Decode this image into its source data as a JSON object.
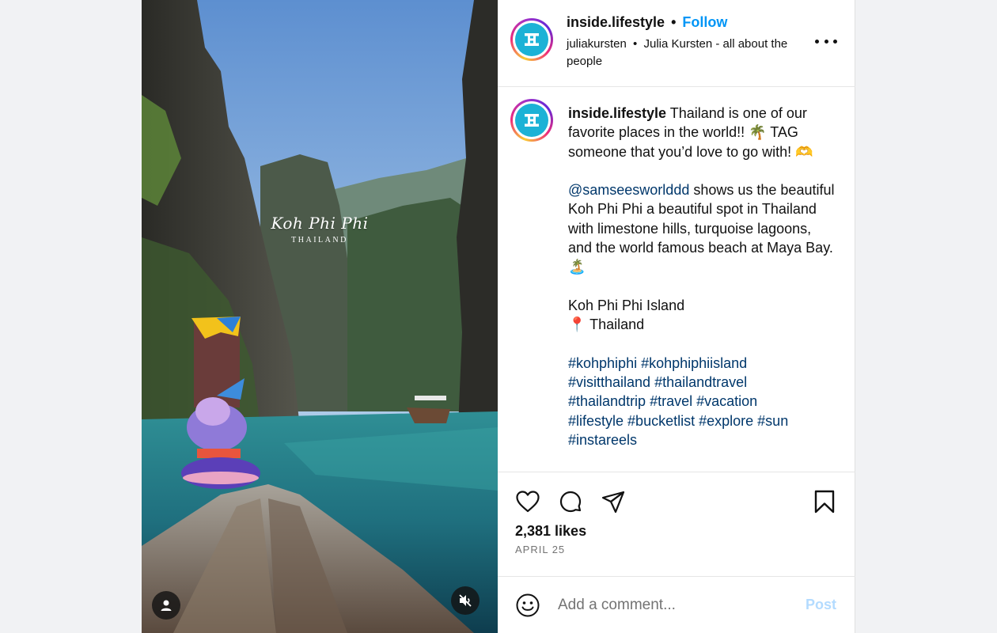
{
  "media": {
    "overlay_title": "Koh Phi Phi",
    "overlay_subtitle": "THAILAND",
    "tag_icon": "user-icon",
    "mute_icon": "speaker-muted-icon"
  },
  "header": {
    "username": "inside.lifestyle",
    "separator": "•",
    "follow_label": "Follow",
    "audio_author": "juliakursten",
    "audio_separator": "•",
    "audio_title": "Julia Kursten - all about the people",
    "more_icon": "more-horizontal-icon"
  },
  "caption": {
    "username": "inside.lifestyle",
    "intro": "Thailand is one of our favorite places in the world!! 🌴 TAG someone that you’d love to go with! 🫶",
    "mention": "@samseesworlddd",
    "body": "shows us the beautiful Koh Phi Phi a beautiful spot in Thailand with limestone hills, turquoise lagoons, and the world famous beach at Maya Bay. 🏝️",
    "location_line1": "Koh Phi Phi Island",
    "location_line2": "📍 Thailand",
    "hashtags": [
      "#kohphiphi",
      "#kohphiphiisland",
      "#visitthailand",
      "#thailandtravel",
      "#thailandtrip",
      "#travel",
      "#vacation",
      "#lifestyle",
      "#bucketlist",
      "#explore",
      "#sun",
      "#instareels"
    ]
  },
  "actions": {
    "like_icon": "heart-icon",
    "comment_icon": "comment-icon",
    "share_icon": "send-icon",
    "save_icon": "bookmark-icon",
    "likes_text": "2,381 likes",
    "date_text": "APRIL 25"
  },
  "comment": {
    "emoji_icon": "smiley-icon",
    "placeholder": "Add a comment...",
    "post_label": "Post"
  },
  "colors": {
    "follow": "#0095f6",
    "link": "#00376b",
    "post_disabled": "#b3dbff",
    "brand_logo": "#1cb2d6"
  }
}
